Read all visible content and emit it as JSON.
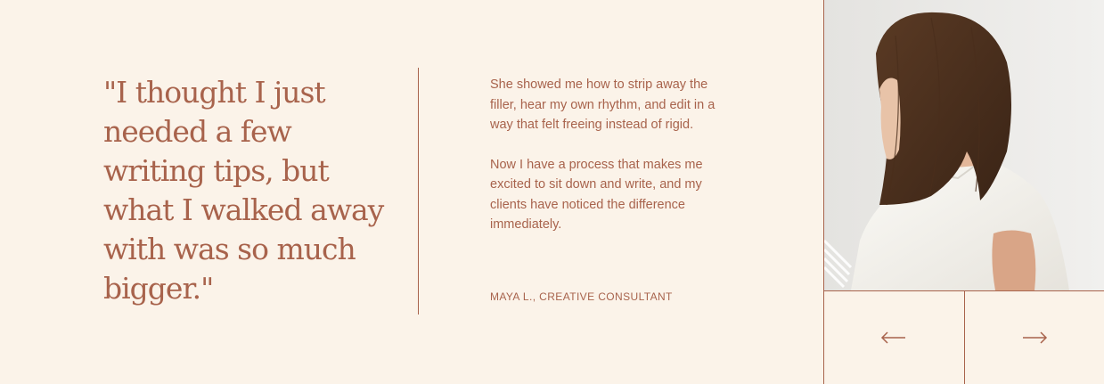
{
  "testimonial": {
    "quote": "\"I thought I just needed a few writing tips, but what I walked away with was so much bigger.\"",
    "paragraphs": [
      "She showed me how to strip away the filler, hear my own rhythm, and edit in a way that felt freeing instead of rigid.",
      "Now I have a process that makes me excited to sit down and write, and my clients have noticed the difference immediately."
    ],
    "attribution": "MAYA L., CREATIVE CONSULTANT"
  },
  "navigation": {
    "prev_icon": "arrow-left-icon",
    "next_icon": "arrow-right-icon"
  },
  "colors": {
    "background": "#fbf3e9",
    "accent": "#a8634c"
  }
}
